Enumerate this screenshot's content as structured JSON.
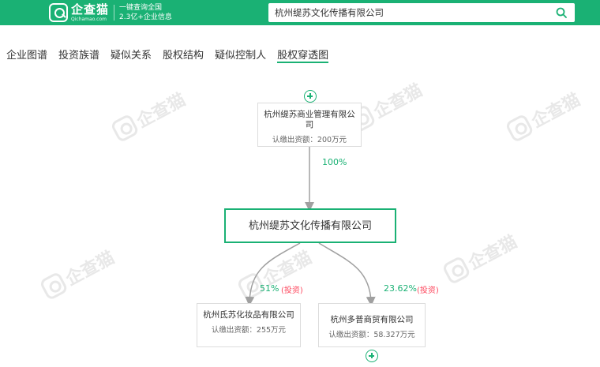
{
  "header": {
    "logo_name": "企查猫",
    "logo_domain": "Qichamao.com",
    "slogan_line1": "一键查询全国",
    "slogan_line2": "2.3亿+企业信息",
    "search_value": "杭州缇苏文化传播有限公司",
    "search_icon": "search-icon",
    "brand_color": "#1ab174"
  },
  "tabs": [
    "企业图谱",
    "投资族谱",
    "疑似关系",
    "股权结构",
    "疑似控制人",
    "股权穿透图"
  ],
  "active_tab": "股权穿透图",
  "watermark": {
    "text": "企查猫",
    "domain": "Qichamao.com"
  },
  "graph": {
    "shareholder": {
      "name": "杭州缇苏商业管理有限公司",
      "capital": "认缴出资额：200万元",
      "percent": "100%"
    },
    "company": {
      "name": "杭州缇苏文化传播有限公司"
    },
    "investments": [
      {
        "name": "杭州氐苏化妆品有限公司",
        "capital": "认缴出资额：255万元",
        "percent": "51%",
        "badge": "(投资)"
      },
      {
        "name": "杭州多普商贸有限公司",
        "capital": "认缴出资额：58.327万元",
        "percent": "23.62%",
        "badge": "(投资)"
      }
    ]
  }
}
